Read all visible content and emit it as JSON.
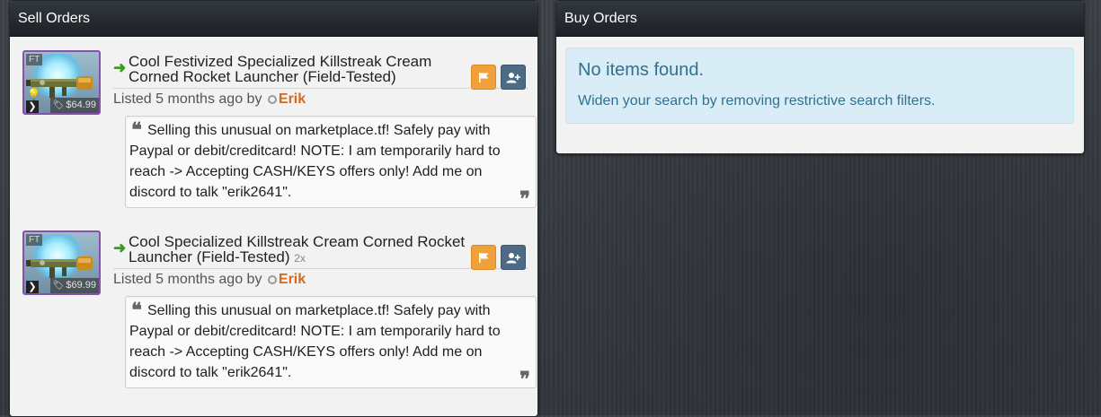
{
  "sell_orders": {
    "title": "Sell Orders",
    "items": [
      {
        "quality": "FT",
        "price": "$64.99",
        "name": "Cool Festivized Specialized Killstreak Cream Corned Rocket Launcher (Field-Tested)",
        "count": "",
        "listed_prefix": "Listed 5 months ago by",
        "user": "Erik",
        "quote": "Selling this unusual on marketplace.tf! Safely pay with Paypal or debit/creditcard! NOTE: I am temporarily hard to reach -> Accepting CASH/KEYS offers only! Add me on discord to talk \"erik2641\"."
      },
      {
        "quality": "FT",
        "price": "$69.99",
        "name": "Cool Specialized Killstreak Cream Corned Rocket Launcher (Field-Tested)",
        "count": "2x",
        "listed_prefix": "Listed 5 months ago by",
        "user": "Erik",
        "quote": "Selling this unusual on marketplace.tf! Safely pay with Paypal or debit/creditcard! NOTE: I am temporarily hard to reach -> Accepting CASH/KEYS offers only! Add me on discord to talk \"erik2641\"."
      }
    ]
  },
  "buy_orders": {
    "title": "Buy Orders",
    "empty_title": "No items found.",
    "empty_text": "Widen your search by removing restrictive search filters."
  },
  "icons": {
    "arrow": "arrow-right-icon",
    "flag": "flag-icon",
    "add_friend": "user-plus-icon",
    "status": "offline-circle-icon",
    "quote_open": "quote-left-icon",
    "quote_close": "quote-right-icon",
    "price_tag": "tag-icon",
    "killstreak": "killstreak-icon"
  },
  "colors": {
    "item_border_unusual": "#8650ac",
    "flag_button": "#f0a13a",
    "add_button": "#4e6b85",
    "username": "#d2691e",
    "arrow": "#3a9b1e",
    "alert_bg": "#d9edf7",
    "alert_text": "#31708f"
  }
}
